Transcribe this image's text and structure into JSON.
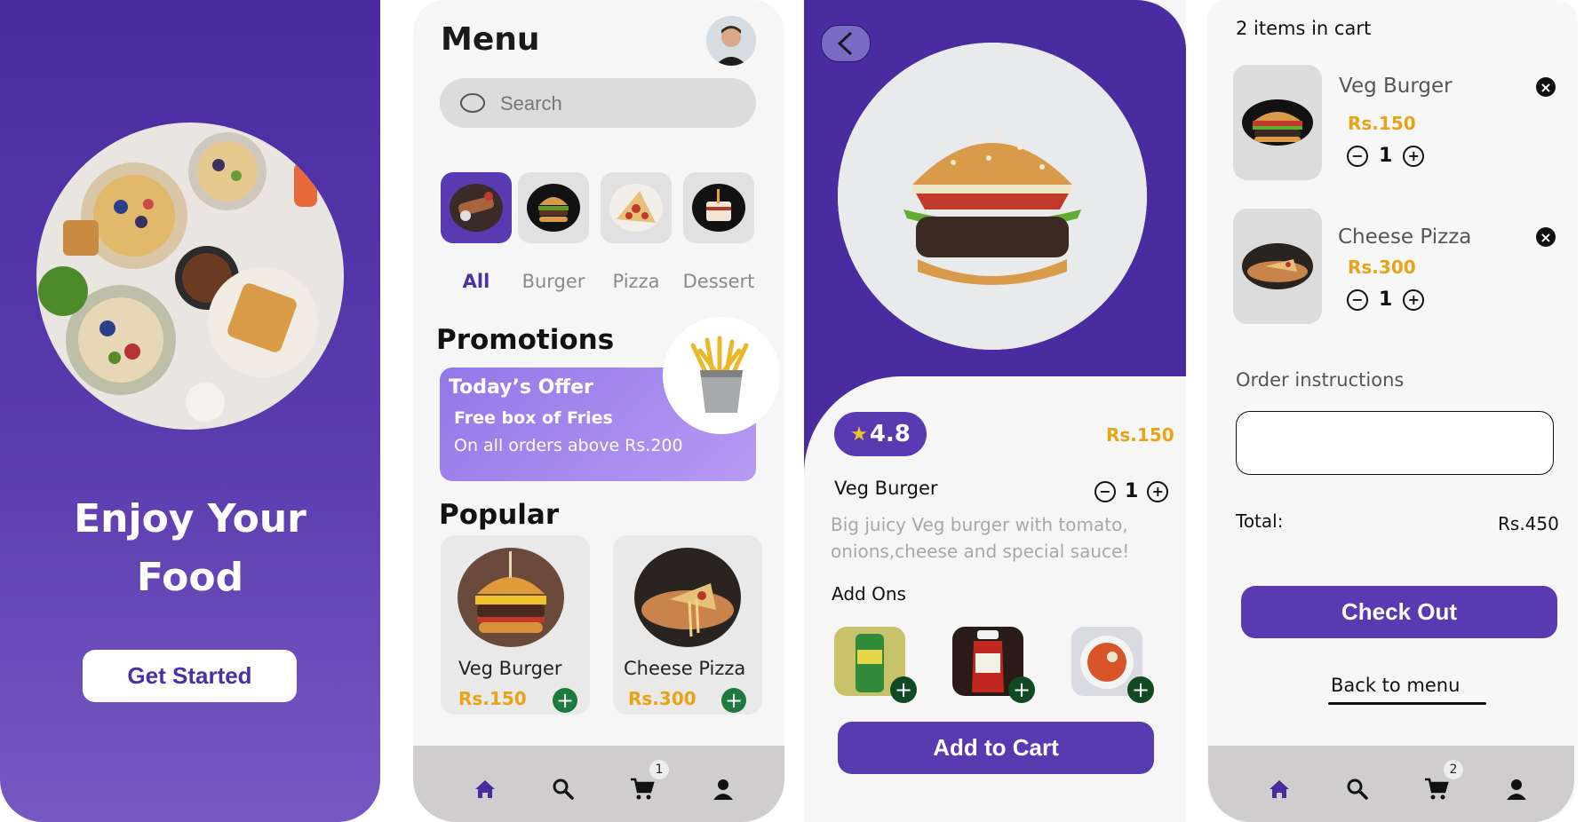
{
  "colors": {
    "primary": "#4a2ca0",
    "accent_price": "#e8a317",
    "add_green": "#1d7a3d"
  },
  "welcome": {
    "title_line1": "Enjoy Your",
    "title_line2": "Food",
    "button": "Get Started"
  },
  "menu": {
    "title": "Menu",
    "search_placeholder": "Search",
    "categories": [
      {
        "label": "All",
        "icon": "bbq-plate-icon",
        "active": true
      },
      {
        "label": "Burger",
        "icon": "burger-icon",
        "active": false
      },
      {
        "label": "Pizza",
        "icon": "pizza-icon",
        "active": false
      },
      {
        "label": "Dessert",
        "icon": "dessert-icon",
        "active": false
      }
    ],
    "promotions_title": "Promotions",
    "promo": {
      "headline": "Today’s Offer",
      "subline": "Free box of Fries",
      "detail": "On all orders above Rs.200"
    },
    "popular_title": "Popular",
    "popular": [
      {
        "name": "Veg Burger",
        "price": "Rs.150"
      },
      {
        "name": "Cheese Pizza",
        "price": "Rs.300"
      }
    ],
    "nav": {
      "cart_badge": "1"
    }
  },
  "detail": {
    "rating": "4.8",
    "price": "Rs.150",
    "name": "Veg Burger",
    "quantity": "1",
    "description": "Big juicy Veg  burger with tomato, onions,cheese and special sauce!",
    "addons_title": "Add Ons",
    "addons": [
      "soda-can-icon",
      "ketchup-bottle-icon",
      "soup-bowl-icon"
    ],
    "add_to_cart": "Add to Cart"
  },
  "cart": {
    "count_text": "2 items in cart",
    "items": [
      {
        "name": "Veg Burger",
        "price": "Rs.150",
        "qty": "1"
      },
      {
        "name": "Cheese Pizza",
        "price": "Rs.300",
        "qty": "1"
      }
    ],
    "instructions_label": "Order instructions",
    "instructions_value": "",
    "total_label": "Total:",
    "total_value": "Rs.450",
    "checkout": "Check Out",
    "back_to_menu": "Back to menu",
    "nav": {
      "cart_badge": "2"
    }
  }
}
